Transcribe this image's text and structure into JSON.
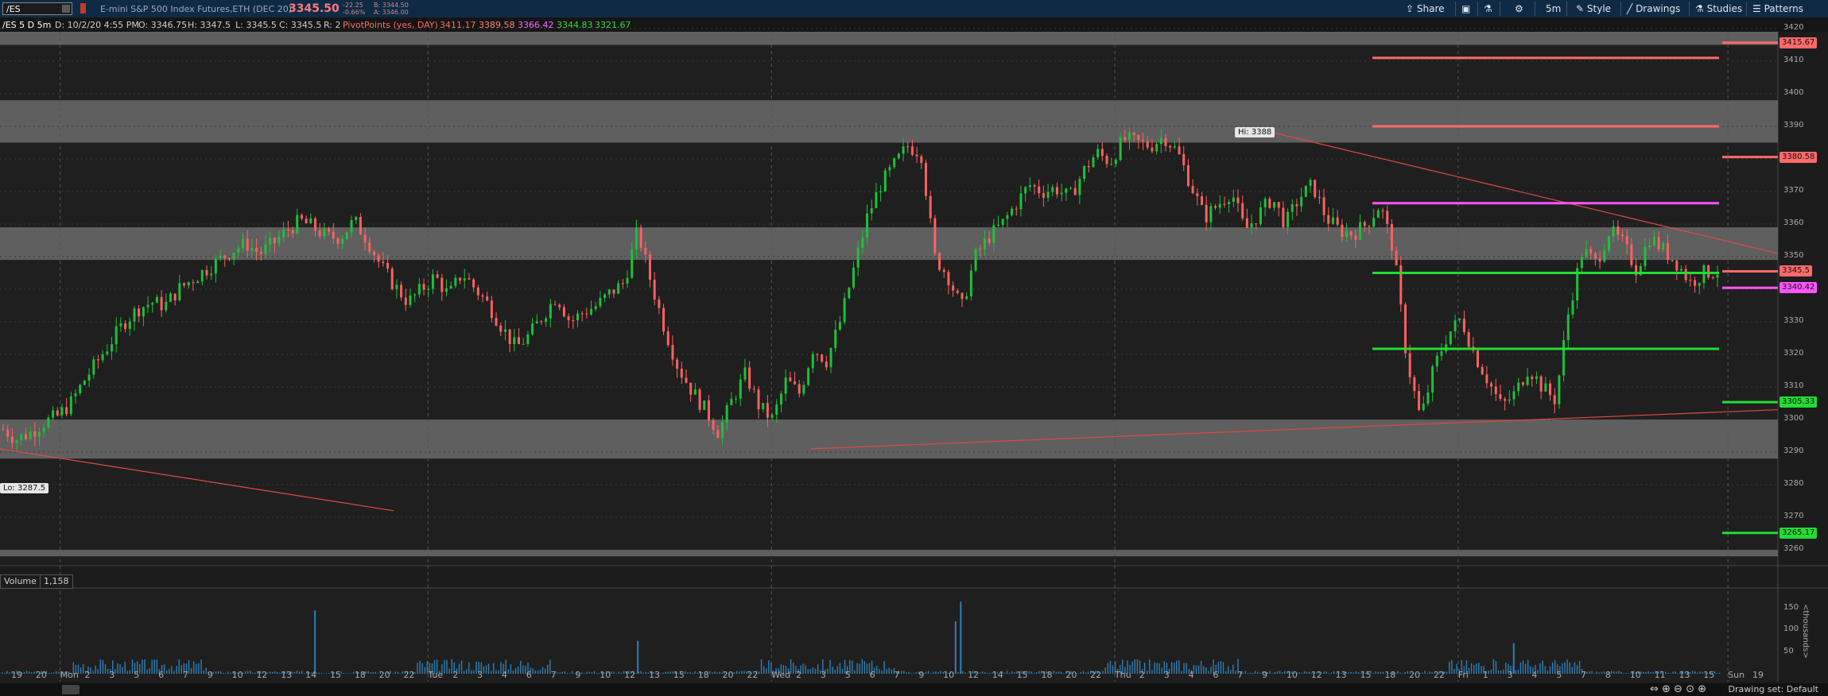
{
  "toolbar": {
    "symbol": "/ES",
    "title": "E-mini S&P 500 Index Futures,ETH (DEC 20)",
    "last_price": "3345.50",
    "change": "-22.25",
    "change_pct": "-0.66%",
    "bid": "B: 3344.50",
    "ask": "A: 3346.00",
    "share": "Share",
    "interval": "5m",
    "style": "Style",
    "drawings": "Drawings",
    "studies": "Studies",
    "patterns": "Patterns"
  },
  "infobar": {
    "symbol": "/ES 5 D 5m",
    "date": "D: 10/2/20 4:55 PM",
    "open": "O: 3346.75",
    "high": "H: 3347.5",
    "low": "L: 3345.5",
    "close": "C: 3345.5",
    "range": "R: 2",
    "pivot_label": "PivotPoints (yes, DAY)",
    "pivots": [
      "3411.17",
      "3389.58",
      "3366.42",
      "3344.83",
      "3321.67"
    ]
  },
  "colors": {
    "up": "#1fbf3a",
    "down": "#ff6060",
    "resistance": "#ff6a6a",
    "pivot": "#ff55ff",
    "support": "#22dd33",
    "zone": "#6b6b6b",
    "volume": "#2e7fb5"
  },
  "chart_data": {
    "type": "candlestick",
    "y_ticks": [
      3420,
      3410,
      3400,
      3390,
      3380,
      3370,
      3360,
      3350,
      3340,
      3330,
      3320,
      3310,
      3300,
      3290,
      3280,
      3270,
      3260
    ],
    "ylim": [
      3256,
      3423
    ],
    "x_ticks": [
      "19",
      "20",
      "Mon",
      "2",
      "3",
      "5",
      "6",
      "7",
      "9",
      "10",
      "12",
      "13",
      "14",
      "15",
      "18",
      "20",
      "22",
      "Tue",
      "2",
      "3",
      "4",
      "6",
      "7",
      "9",
      "10",
      "12",
      "13",
      "15",
      "18",
      "20",
      "22",
      "Wed",
      "2",
      "3",
      "5",
      "6",
      "7",
      "9",
      "10",
      "12",
      "14",
      "15",
      "18",
      "20",
      "22",
      "Thu",
      "2",
      "3",
      "4",
      "6",
      "7",
      "9",
      "10",
      "12",
      "13",
      "15",
      "18",
      "20",
      "22",
      "Fri",
      "1",
      "3",
      "4",
      "5",
      "7",
      "8",
      "10",
      "11",
      "13",
      "15",
      "Sun",
      "19"
    ],
    "zones": [
      [
        3415,
        3430
      ],
      [
        3385,
        3398
      ],
      [
        3349,
        3359
      ],
      [
        3288,
        3300
      ],
      [
        3258,
        3260
      ]
    ],
    "pivot_lines": [
      {
        "value": 3411,
        "role": "resistance"
      },
      {
        "value": 3390,
        "role": "resistance"
      },
      {
        "value": 3366.4,
        "role": "pivot"
      },
      {
        "value": 3345,
        "role": "support"
      },
      {
        "value": 3321.7,
        "role": "support"
      }
    ],
    "right_markers": [
      {
        "label": "3415.67",
        "value": 3415.67,
        "role": "resistance"
      },
      {
        "label": "3380.58",
        "value": 3380.58,
        "role": "resistance"
      },
      {
        "label": "3345.5",
        "value": 3345.5,
        "role": "last"
      },
      {
        "label": "3340.42",
        "value": 3340.42,
        "role": "pivot"
      },
      {
        "label": "3305.33",
        "value": 3305.33,
        "role": "support"
      },
      {
        "label": "3265.17",
        "value": 3265.17,
        "role": "support"
      }
    ],
    "hi_label": "Hi: 3388",
    "lo_label": "Lo: 3287.5",
    "price_path": [
      3297,
      3294,
      3296,
      3299,
      3301,
      3305,
      3312,
      3318,
      3324,
      3330,
      3334,
      3336,
      3335,
      3340,
      3343,
      3346,
      3349,
      3352,
      3354,
      3351,
      3354,
      3358,
      3361,
      3359,
      3356,
      3356,
      3361,
      3355,
      3347,
      3341,
      3336,
      3340,
      3344,
      3338,
      3345,
      3340,
      3335,
      3328,
      3322,
      3326,
      3332,
      3338,
      3330,
      3333,
      3335,
      3339,
      3342,
      3358,
      3342,
      3328,
      3316,
      3309,
      3303,
      3296,
      3306,
      3314,
      3304,
      3300,
      3312,
      3308,
      3322,
      3318,
      3330,
      3346,
      3362,
      3372,
      3378,
      3384,
      3382,
      3350,
      3344,
      3334,
      3350,
      3356,
      3360,
      3366,
      3372,
      3370,
      3371,
      3368,
      3376,
      3382,
      3379,
      3386,
      3385,
      3384,
      3387,
      3382,
      3372,
      3362,
      3366,
      3370,
      3358,
      3363,
      3368,
      3360,
      3368,
      3372,
      3362,
      3358,
      3357,
      3360,
      3366,
      3352,
      3318,
      3300,
      3316,
      3326,
      3331,
      3320,
      3312,
      3304,
      3308,
      3316,
      3310,
      3306,
      3334,
      3352,
      3348,
      3358,
      3354,
      3346,
      3356,
      3352,
      3348,
      3342,
      3345,
      3345.5
    ],
    "volume_ticks": [
      150,
      100,
      50
    ],
    "volume_unit": "<thousands>",
    "volume_spikes": [
      {
        "at": 0.182,
        "value": 145
      },
      {
        "at": 0.37,
        "value": 75
      },
      {
        "at": 0.555,
        "value": 120
      },
      {
        "at": 0.558,
        "value": 165
      },
      {
        "at": 0.88,
        "value": 70
      }
    ]
  },
  "volume": {
    "label": "Volume",
    "value": "1,158"
  },
  "status": {
    "drawing_set": "Drawing set: Default"
  }
}
